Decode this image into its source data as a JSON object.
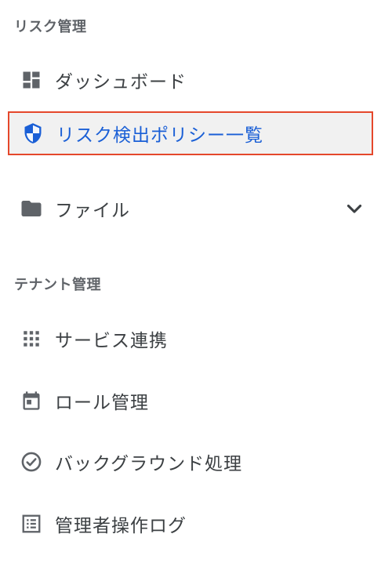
{
  "sections": {
    "risk": {
      "title": "リスク管理",
      "items": [
        {
          "label": "ダッシュボード",
          "icon": "dashboard-icon"
        },
        {
          "label": "リスク検出ポリシー一覧",
          "icon": "shield-icon",
          "active": true
        },
        {
          "label": "ファイル",
          "icon": "folder-icon",
          "expandable": true
        }
      ]
    },
    "tenant": {
      "title": "テナント管理",
      "items": [
        {
          "label": "サービス連携",
          "icon": "apps-grid-icon"
        },
        {
          "label": "ロール管理",
          "icon": "calendar-icon"
        },
        {
          "label": "バックグラウンド処理",
          "icon": "check-circle-icon"
        },
        {
          "label": "管理者操作ログ",
          "icon": "list-alt-icon"
        }
      ]
    }
  },
  "colors": {
    "active_text": "#1a5fd6",
    "active_border": "#e5472b",
    "active_bg": "#f1f1f1",
    "icon": "#5f6368"
  }
}
